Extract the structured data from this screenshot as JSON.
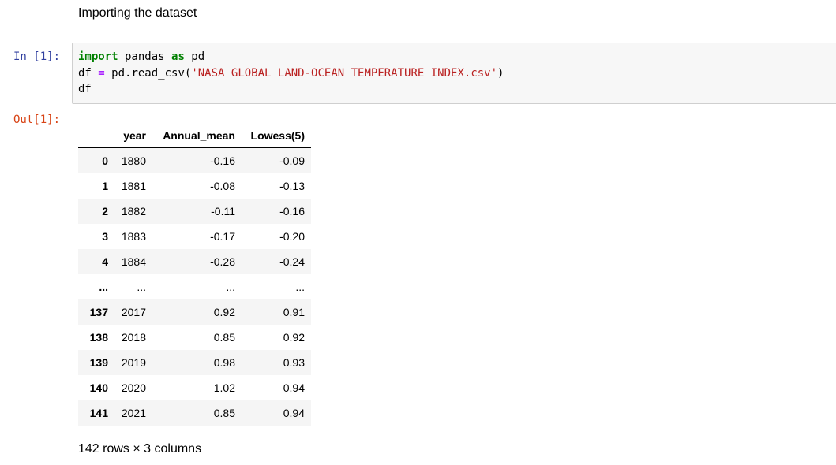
{
  "markdown": {
    "heading": "Importing the dataset"
  },
  "input_cell": {
    "prompt": "In [1]:",
    "code": {
      "line1": {
        "kw1": "import",
        "name": " pandas ",
        "kw2": "as",
        "alias": " pd"
      },
      "line2": {
        "lhs": "df ",
        "eq": "=",
        "call": " pd.read_csv(",
        "str": "'NASA GLOBAL LAND-OCEAN TEMPERATURE INDEX.csv'",
        "close": ")"
      },
      "line3": "df"
    }
  },
  "output_cell": {
    "prompt": "Out[1]:",
    "table": {
      "columns": [
        "",
        "year",
        "Annual_mean",
        "Lowess(5)"
      ],
      "rows": [
        {
          "index": "0",
          "year": "1880",
          "annual_mean": "-0.16",
          "lowess": "-0.09"
        },
        {
          "index": "1",
          "year": "1881",
          "annual_mean": "-0.08",
          "lowess": "-0.13"
        },
        {
          "index": "2",
          "year": "1882",
          "annual_mean": "-0.11",
          "lowess": "-0.16"
        },
        {
          "index": "3",
          "year": "1883",
          "annual_mean": "-0.17",
          "lowess": "-0.20"
        },
        {
          "index": "4",
          "year": "1884",
          "annual_mean": "-0.28",
          "lowess": "-0.24"
        },
        {
          "index": "...",
          "year": "...",
          "annual_mean": "...",
          "lowess": "..."
        },
        {
          "index": "137",
          "year": "2017",
          "annual_mean": "0.92",
          "lowess": "0.91"
        },
        {
          "index": "138",
          "year": "2018",
          "annual_mean": "0.85",
          "lowess": "0.92"
        },
        {
          "index": "139",
          "year": "2019",
          "annual_mean": "0.98",
          "lowess": "0.93"
        },
        {
          "index": "140",
          "year": "2020",
          "annual_mean": "1.02",
          "lowess": "0.94"
        },
        {
          "index": "141",
          "year": "2021",
          "annual_mean": "0.85",
          "lowess": "0.94"
        }
      ]
    },
    "shape_text": "142 rows × 3 columns"
  },
  "colors": {
    "in_prompt": "#303F9F",
    "out_prompt": "#D84315",
    "keyword": "#008000",
    "operator": "#AA22FF",
    "string": "#BA2121",
    "cell_background": "#f7f7f7",
    "cell_border": "#cfcfcf"
  }
}
